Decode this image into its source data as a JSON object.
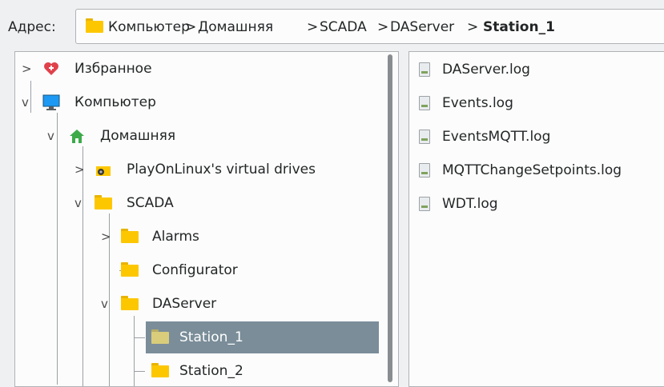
{
  "address": {
    "label": "Адрес:",
    "crumbs": [
      "Компьютер",
      "Домашняя",
      "SCADA",
      "DAServer",
      "Station_1"
    ],
    "separator": ">"
  },
  "tree": [
    {
      "label": "Избранное",
      "icon": "heart-icon",
      "expander": ">",
      "level": 0
    },
    {
      "label": "Компьютер",
      "icon": "monitor-icon",
      "expander": "v",
      "level": 0
    },
    {
      "label": "Домашняя",
      "icon": "home-icon",
      "expander": "v",
      "level": 1
    },
    {
      "label": "PlayOnLinux's virtual drives",
      "icon": "drive-folder-icon",
      "expander": ">",
      "level": 2
    },
    {
      "label": "SCADA",
      "icon": "folder-icon",
      "expander": "v",
      "level": 2
    },
    {
      "label": "Alarms",
      "icon": "folder-icon",
      "expander": ">",
      "level": 3
    },
    {
      "label": "Configurator",
      "icon": "folder-icon",
      "expander": "",
      "level": 3
    },
    {
      "label": "DAServer",
      "icon": "folder-icon",
      "expander": "v",
      "level": 3
    },
    {
      "label": "Station_1",
      "icon": "folder-icon",
      "expander": "",
      "level": 4,
      "selected": true
    },
    {
      "label": "Station_2",
      "icon": "folder-icon",
      "expander": "",
      "level": 4
    }
  ],
  "files": [
    {
      "name": "DAServer.log",
      "icon": "log-file-icon"
    },
    {
      "name": "Events.log",
      "icon": "log-file-icon"
    },
    {
      "name": "EventsMQTT.log",
      "icon": "log-file-icon"
    },
    {
      "name": "MQTTChangeSetpoints.log",
      "icon": "log-file-icon"
    },
    {
      "name": "WDT.log",
      "icon": "log-file-icon"
    }
  ],
  "colors": {
    "selection": "#7a8d99",
    "folder": "#fdc700",
    "background": "#eff0f1"
  }
}
